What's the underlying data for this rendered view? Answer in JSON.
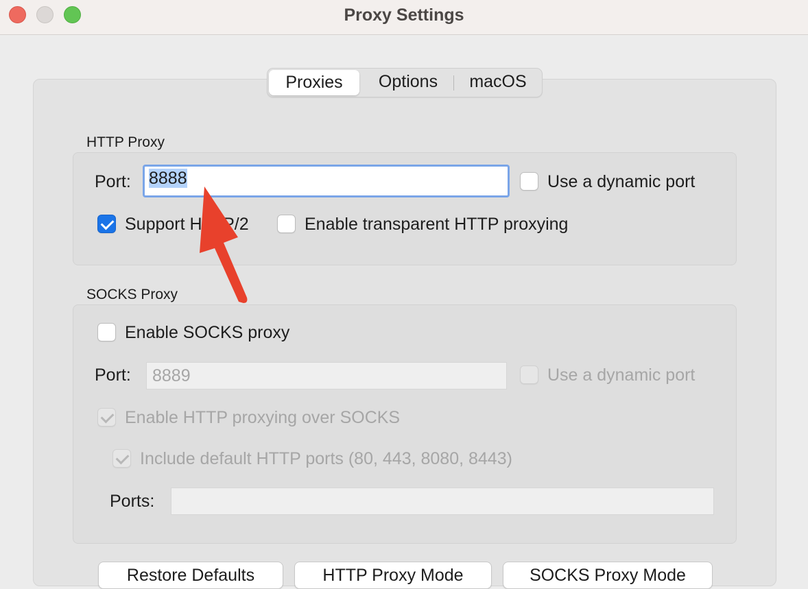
{
  "window": {
    "title": "Proxy Settings"
  },
  "tabs": [
    {
      "label": "Proxies",
      "active": true
    },
    {
      "label": "Options",
      "active": false
    },
    {
      "label": "macOS",
      "active": false
    }
  ],
  "http_proxy": {
    "section_label": "HTTP Proxy",
    "port_label": "Port:",
    "port_value": "8888",
    "dynamic_port_label": "Use a dynamic port",
    "dynamic_port_checked": false,
    "http2_label": "Support HTTP/2",
    "http2_checked": true,
    "transparent_label": "Enable transparent HTTP proxying",
    "transparent_checked": false
  },
  "socks_proxy": {
    "section_label": "SOCKS Proxy",
    "enable_label": "Enable SOCKS proxy",
    "enable_checked": false,
    "port_label": "Port:",
    "port_value": "8889",
    "dynamic_port_label": "Use a dynamic port",
    "dynamic_port_checked": false,
    "http_over_socks_label": "Enable HTTP proxying over SOCKS",
    "http_over_socks_checked": true,
    "include_default_label": "Include default HTTP ports (80, 443, 8080, 8443)",
    "include_default_checked": true,
    "ports_label": "Ports:",
    "ports_value": ""
  },
  "bottom_buttons": [
    {
      "label": "Restore Defaults"
    },
    {
      "label": "HTTP Proxy Mode"
    },
    {
      "label": "SOCKS Proxy Mode"
    }
  ],
  "annotation": {
    "arrow_color": "#e8412c"
  },
  "colors": {
    "accent": "#1a74e8",
    "focus_ring": "#7aa5e8",
    "selection": "#b3d2fb"
  }
}
